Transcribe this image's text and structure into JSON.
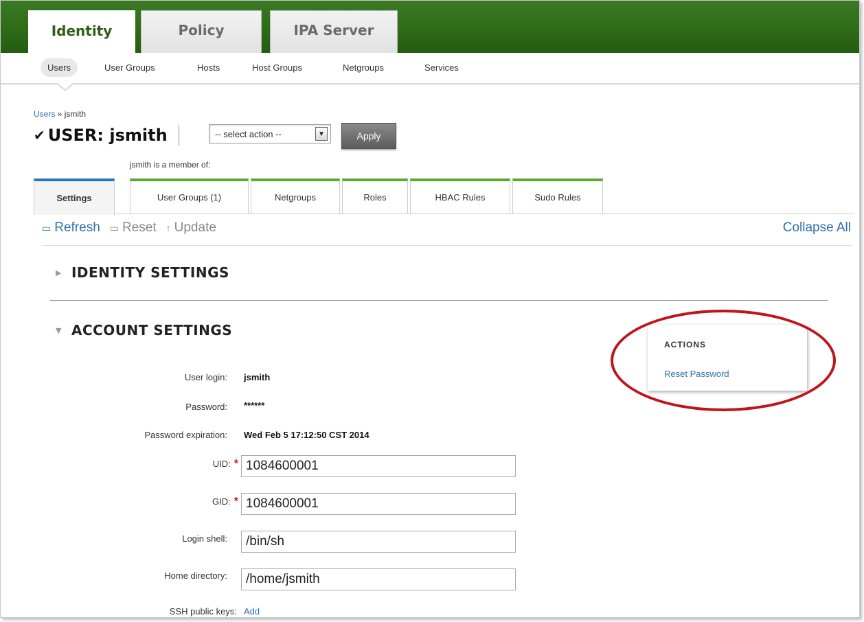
{
  "nav": {
    "top_tabs": [
      "Identity",
      "Policy",
      "IPA Server"
    ],
    "sub_items": [
      "Users",
      "User Groups",
      "Hosts",
      "Host Groups",
      "Netgroups",
      "Services"
    ]
  },
  "breadcrumb": {
    "link": "Users",
    "separator": " » ",
    "current": "jsmith"
  },
  "title": {
    "check": "✔",
    "text": "USER: jsmith"
  },
  "action_select": {
    "value": "-- select action --"
  },
  "apply_label": "Apply",
  "member_of_label": "jsmith is a member of:",
  "tabs": [
    "Settings",
    "User Groups (1)",
    "Netgroups",
    "Roles",
    "HBAC Rules",
    "Sudo Rules"
  ],
  "facet_controls": {
    "refresh": "Refresh",
    "reset": "Reset",
    "update": "Update",
    "collapse_all": "Collapse All"
  },
  "sections": {
    "identity": "IDENTITY SETTINGS",
    "account": "ACCOUNT SETTINGS"
  },
  "actions_box": {
    "heading": "ACTIONS",
    "reset_password": "Reset Password"
  },
  "account": {
    "user_login_label": "User login:",
    "user_login": "jsmith",
    "password_label": "Password:",
    "password": "******",
    "expiration_label": "Password expiration:",
    "expiration": "Wed Feb 5 17:12:50 CST 2014",
    "uid_label": "UID:",
    "uid": "1084600001",
    "gid_label": "GID:",
    "gid": "1084600001",
    "shell_label": "Login shell:",
    "shell": "/bin/sh",
    "home_label": "Home directory:",
    "home": "/home/jsmith",
    "ssh_label": "SSH public keys:",
    "ssh_add": "Add",
    "required_mark": "*"
  },
  "colors": {
    "header_green": "#2c6a16",
    "link_blue": "#2f6fb1",
    "highlight_red": "#c0141b"
  }
}
